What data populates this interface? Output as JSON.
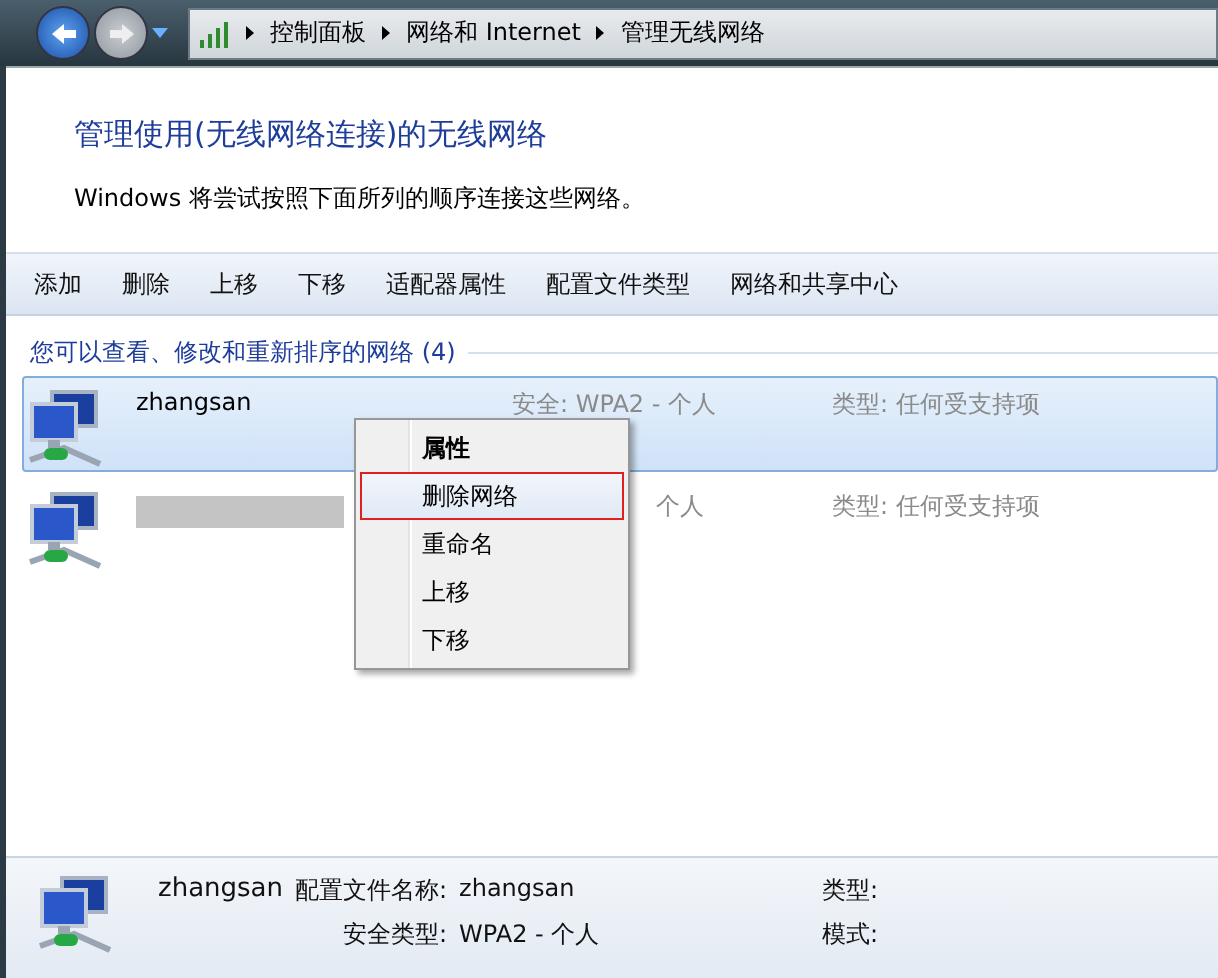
{
  "address_bar": {
    "crumbs": [
      "控制面板",
      "网络和 Internet",
      "管理无线网络"
    ]
  },
  "heading": "管理使用(无线网络连接)的无线网络",
  "description": "Windows 将尝试按照下面所列的顺序连接这些网络。",
  "toolbar": [
    "添加",
    "删除",
    "上移",
    "下移",
    "适配器属性",
    "配置文件类型",
    "网络和共享中心"
  ],
  "group_header": "您可以查看、修改和重新排序的网络 (4)",
  "networks": [
    {
      "name": "zhangsan",
      "redacted": false,
      "security": "安全: WPA2 - 个人",
      "type": "类型: 任何受支持项",
      "selected": true
    },
    {
      "redacted": true,
      "security": "个人",
      "type": "类型: 任何受支持项",
      "selected": false
    }
  ],
  "context_menu": [
    {
      "label": "属性",
      "default": true,
      "selected": false
    },
    {
      "label": "删除网络",
      "default": false,
      "selected": true
    },
    {
      "label": "重命名",
      "default": false,
      "selected": false
    },
    {
      "label": "上移",
      "default": false,
      "selected": false
    },
    {
      "label": "下移",
      "default": false,
      "selected": false
    }
  ],
  "details": {
    "name": "zhangsan",
    "profile_label": "配置文件名称:",
    "profile_value": "zhangsan",
    "security_label": "安全类型:",
    "security_value": "WPA2 - 个人",
    "type_label": "类型:",
    "mode_label": "模式:"
  }
}
